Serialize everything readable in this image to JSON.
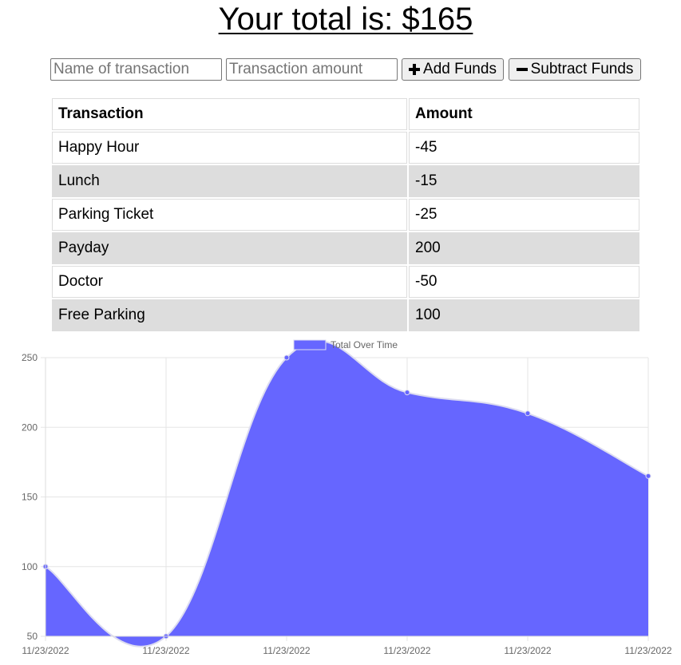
{
  "header": {
    "title": "Your total is: $165"
  },
  "form": {
    "name_placeholder": "Name of transaction",
    "amount_placeholder": "Transaction amount",
    "add_label": "Add Funds",
    "subtract_label": "Subtract Funds",
    "add_icon": "plus-icon",
    "subtract_icon": "minus-icon"
  },
  "table": {
    "headers": [
      "Transaction",
      "Amount"
    ],
    "rows": [
      {
        "name": "Happy Hour",
        "amount": "-45"
      },
      {
        "name": "Lunch",
        "amount": "-15"
      },
      {
        "name": "Parking Ticket",
        "amount": "-25"
      },
      {
        "name": "Payday",
        "amount": "200"
      },
      {
        "name": "Doctor",
        "amount": "-50"
      },
      {
        "name": "Free Parking",
        "amount": "100"
      }
    ],
    "stripe_color": "#dddddd"
  },
  "chart_data": {
    "type": "area",
    "title": "",
    "xlabel": "",
    "ylabel": "",
    "x": [
      "11/23/2022",
      "11/23/2022",
      "11/23/2022",
      "11/23/2022",
      "11/23/2022",
      "11/23/2022"
    ],
    "series": [
      {
        "name": "Total Over Time",
        "values": [
          100,
          50,
          250,
          225,
          210,
          165
        ],
        "color": "#6666ff"
      }
    ],
    "ylim": [
      50,
      250
    ],
    "yticks": [
      50,
      100,
      150,
      200,
      250
    ],
    "grid": true,
    "legend": "top-center"
  }
}
